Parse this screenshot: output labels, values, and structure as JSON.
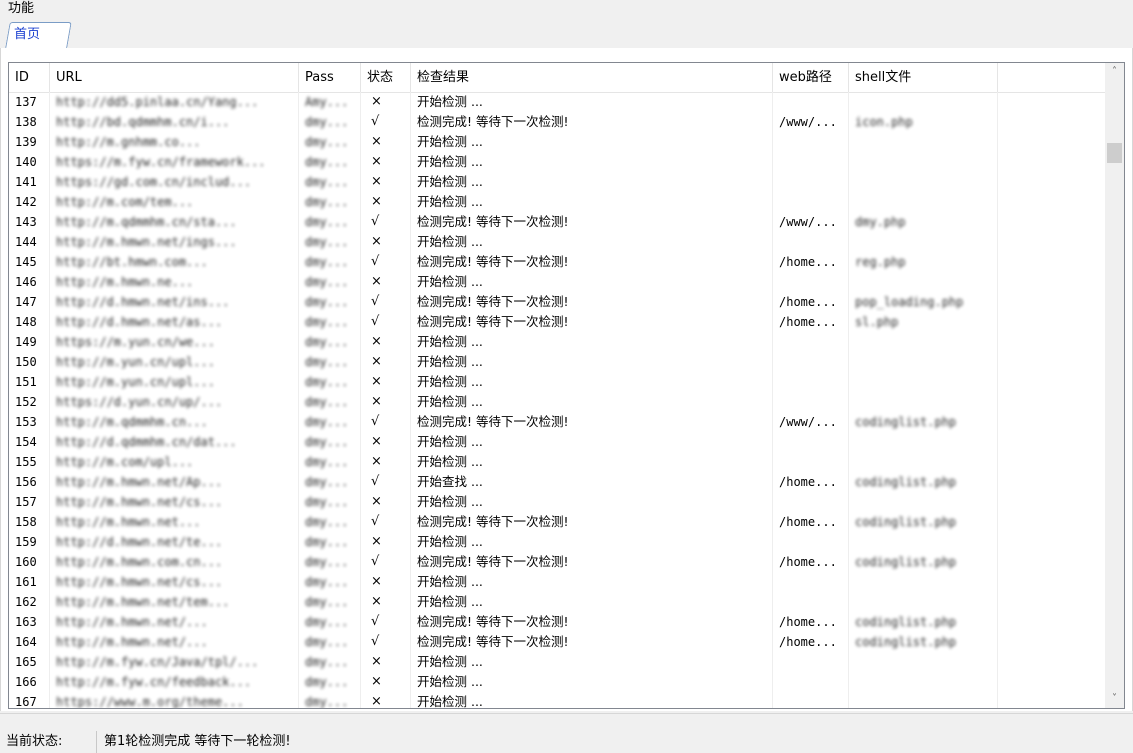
{
  "menubar": {
    "menu_label": "功能"
  },
  "tabs": {
    "home_label": "首页"
  },
  "columns": {
    "id": "ID",
    "url": "URL",
    "pass": "Pass",
    "status": "状态",
    "result": "检查结果",
    "web_path": "web路径",
    "shell_file": "shell文件"
  },
  "status_symbols": {
    "fail": "×",
    "ok": "√"
  },
  "rows": [
    {
      "id": "137",
      "url": "http://dd5.pinlaa.cn/Yang...",
      "pass": "Amy...",
      "status": "×",
      "result": "开始检测 ...",
      "web": "",
      "shell": ""
    },
    {
      "id": "138",
      "url": "http://bd.qdmmhm.cn/i...",
      "pass": "dmy...",
      "status": "√",
      "result": "检测完成! 等待下一次检测!",
      "web": "/www/...",
      "shell": "icon.php"
    },
    {
      "id": "139",
      "url": "http://m.gnhmm.co...",
      "pass": "dmy...",
      "status": "×",
      "result": "开始检测 ...",
      "web": "",
      "shell": ""
    },
    {
      "id": "140",
      "url": "https://m.fyw.cn/framework...",
      "pass": "dmy...",
      "status": "×",
      "result": "开始检测 ...",
      "web": "",
      "shell": ""
    },
    {
      "id": "141",
      "url": "https://gd.com.cn/includ...",
      "pass": "dmy...",
      "status": "×",
      "result": "开始检测 ...",
      "web": "",
      "shell": ""
    },
    {
      "id": "142",
      "url": "http://m.com/tem...",
      "pass": "dmy...",
      "status": "×",
      "result": "开始检测 ...",
      "web": "",
      "shell": ""
    },
    {
      "id": "143",
      "url": "http://m.qdmmhm.cn/sta...",
      "pass": "dmy...",
      "status": "√",
      "result": "检测完成! 等待下一次检测!",
      "web": "/www/...",
      "shell": "dmy.php"
    },
    {
      "id": "144",
      "url": "http://m.hmwn.net/ings...",
      "pass": "dmy...",
      "status": "×",
      "result": "开始检测 ...",
      "web": "",
      "shell": ""
    },
    {
      "id": "145",
      "url": "http://bt.hmwn.com...",
      "pass": "dmy...",
      "status": "√",
      "result": "检测完成! 等待下一次检测!",
      "web": "/home...",
      "shell": "reg.php"
    },
    {
      "id": "146",
      "url": "http://m.hmwn.ne...",
      "pass": "dmy...",
      "status": "×",
      "result": "开始检测 ...",
      "web": "",
      "shell": ""
    },
    {
      "id": "147",
      "url": "http://d.hmwn.net/ins...",
      "pass": "dmy...",
      "status": "√",
      "result": "检测完成! 等待下一次检测!",
      "web": "/home...",
      "shell": "pop_loading.php"
    },
    {
      "id": "148",
      "url": "http://d.hmwn.net/as...",
      "pass": "dmy...",
      "status": "√",
      "result": "检测完成! 等待下一次检测!",
      "web": "/home...",
      "shell": "sl.php"
    },
    {
      "id": "149",
      "url": "https://m.yun.cn/we...",
      "pass": "dmy...",
      "status": "×",
      "result": "开始检测 ...",
      "web": "",
      "shell": ""
    },
    {
      "id": "150",
      "url": "http://m.yun.cn/upl...",
      "pass": "dmy...",
      "status": "×",
      "result": "开始检测 ...",
      "web": "",
      "shell": ""
    },
    {
      "id": "151",
      "url": "http://m.yun.cn/upl...",
      "pass": "dmy...",
      "status": "×",
      "result": "开始检测 ...",
      "web": "",
      "shell": ""
    },
    {
      "id": "152",
      "url": "https://d.yun.cn/up/...",
      "pass": "dmy...",
      "status": "×",
      "result": "开始检测 ...",
      "web": "",
      "shell": ""
    },
    {
      "id": "153",
      "url": "http://m.qdmmhm.cn...",
      "pass": "dmy...",
      "status": "√",
      "result": "检测完成! 等待下一次检测!",
      "web": "/www/...",
      "shell": "codinglist.php"
    },
    {
      "id": "154",
      "url": "http://d.qdmmhm.cn/dat...",
      "pass": "dmy...",
      "status": "×",
      "result": "开始检测 ...",
      "web": "",
      "shell": ""
    },
    {
      "id": "155",
      "url": "http://m.com/upl...",
      "pass": "dmy...",
      "status": "×",
      "result": "开始检测 ...",
      "web": "",
      "shell": ""
    },
    {
      "id": "156",
      "url": "http://m.hmwn.net/Ap...",
      "pass": "dmy...",
      "status": "√",
      "result": "开始查找 ...",
      "web": "/home...",
      "shell": "codinglist.php"
    },
    {
      "id": "157",
      "url": "http://m.hmwn.net/cs...",
      "pass": "dmy...",
      "status": "×",
      "result": "开始检测 ...",
      "web": "",
      "shell": ""
    },
    {
      "id": "158",
      "url": "http://m.hmwn.net...",
      "pass": "dmy...",
      "status": "√",
      "result": "检测完成! 等待下一次检测!",
      "web": "/home...",
      "shell": "codinglist.php"
    },
    {
      "id": "159",
      "url": "http://d.hmwn.net/te...",
      "pass": "dmy...",
      "status": "×",
      "result": "开始检测 ...",
      "web": "",
      "shell": ""
    },
    {
      "id": "160",
      "url": "http://m.hmwn.com.cn...",
      "pass": "dmy...",
      "status": "√",
      "result": "检测完成! 等待下一次检测!",
      "web": "/home...",
      "shell": "codinglist.php"
    },
    {
      "id": "161",
      "url": "http://m.hmwn.net/cs...",
      "pass": "dmy...",
      "status": "×",
      "result": "开始检测 ...",
      "web": "",
      "shell": ""
    },
    {
      "id": "162",
      "url": "http://m.hmwn.net/tem...",
      "pass": "dmy...",
      "status": "×",
      "result": "开始检测 ...",
      "web": "",
      "shell": ""
    },
    {
      "id": "163",
      "url": "http://m.hmwn.net/...",
      "pass": "dmy...",
      "status": "√",
      "result": "检测完成! 等待下一次检测!",
      "web": "/home...",
      "shell": "codinglist.php"
    },
    {
      "id": "164",
      "url": "http://m.hmwn.net/...",
      "pass": "dmy...",
      "status": "√",
      "result": "检测完成! 等待下一次检测!",
      "web": "/home...",
      "shell": "codinglist.php"
    },
    {
      "id": "165",
      "url": "http://m.fyw.cn/Java/tpl/...",
      "pass": "dmy...",
      "status": "×",
      "result": "开始检测 ...",
      "web": "",
      "shell": ""
    },
    {
      "id": "166",
      "url": "http://m.fyw.cn/feedback...",
      "pass": "dmy...",
      "status": "×",
      "result": "开始检测 ...",
      "web": "",
      "shell": ""
    },
    {
      "id": "167",
      "url": "https://www.m.org/theme...",
      "pass": "dmy...",
      "status": "×",
      "result": "开始检测 ...",
      "web": "",
      "shell": ""
    }
  ],
  "statusbar": {
    "label": "当前状态:",
    "text": "第1轮检测完成 等待下一轮检测!"
  },
  "scrollbar": {
    "up_arrow": "˄",
    "down_arrow": "˅"
  }
}
